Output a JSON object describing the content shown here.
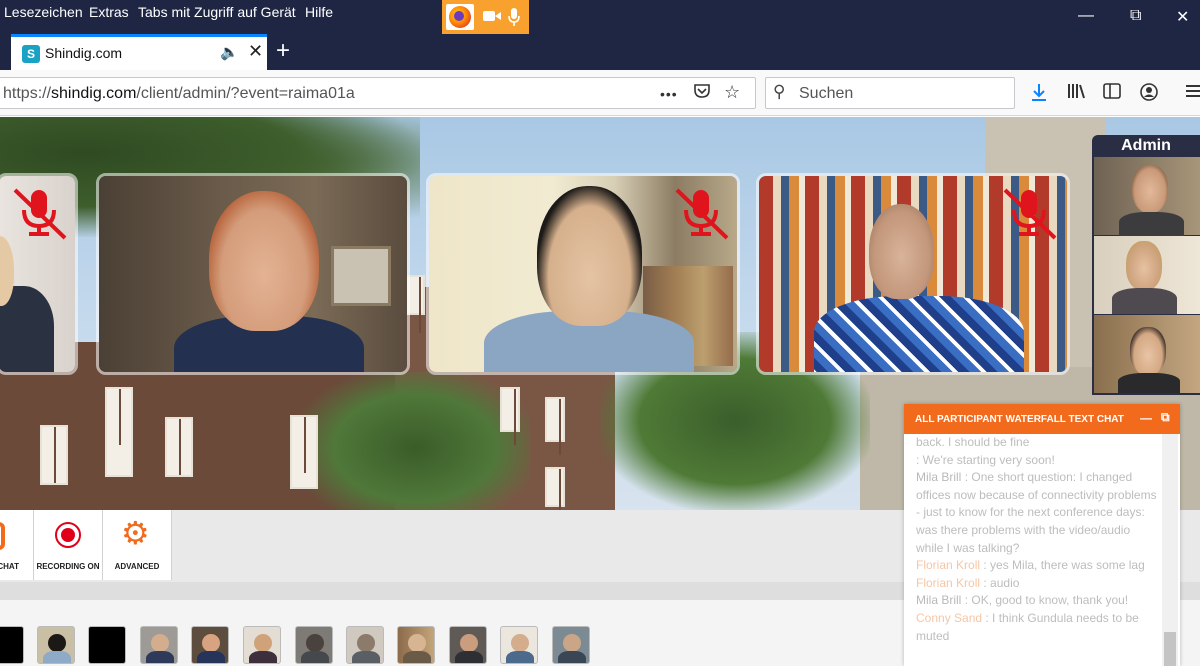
{
  "menubar": {
    "items": [
      "Lesezeichen",
      "Extras",
      "Tabs mit Zugriff auf Gerät",
      "Hilfe"
    ],
    "window_controls": [
      "minimize-icon",
      "restore-icon",
      "close-icon"
    ]
  },
  "tab": {
    "title": "Shindig.com",
    "favicon_letter": "S",
    "new_tab_label": "+"
  },
  "navbar": {
    "url_prefix": "https://",
    "url_host": "shindig.com",
    "url_path": "/client/admin/?event=raima01a",
    "more_label": "•••",
    "search_placeholder": "Suchen"
  },
  "admin_panel": {
    "label": "Admin"
  },
  "toolbar": {
    "chat_label": "CHAT",
    "recording_label": "RECORDING ON",
    "advanced_label": "ADVANCED",
    "accent_color": "#f26b1d",
    "record_color": "#e0001a"
  },
  "chat": {
    "title": "ALL PARTICIPANT WATERFALL TEXT CHAT",
    "messages": [
      {
        "name": "",
        "text": "back. I should be fine"
      },
      {
        "name": "",
        "text": ": We're starting very soon!"
      },
      {
        "name": "Mila Brill",
        "text": ": One short question: I changed offices now because of connectivity problems - just to know for the next conference days: was there problems with the video/audio while I was talking?"
      },
      {
        "name": "Florian Kroll",
        "text": ": yes Mila, there was some lag"
      },
      {
        "name": "Florian Kroll",
        "text": ": audio"
      },
      {
        "name": "Mila Brill",
        "text": ": OK, good to know, thank you!"
      },
      {
        "name": "Conny Sand",
        "text": ": I think Gundula needs to be muted"
      }
    ]
  }
}
